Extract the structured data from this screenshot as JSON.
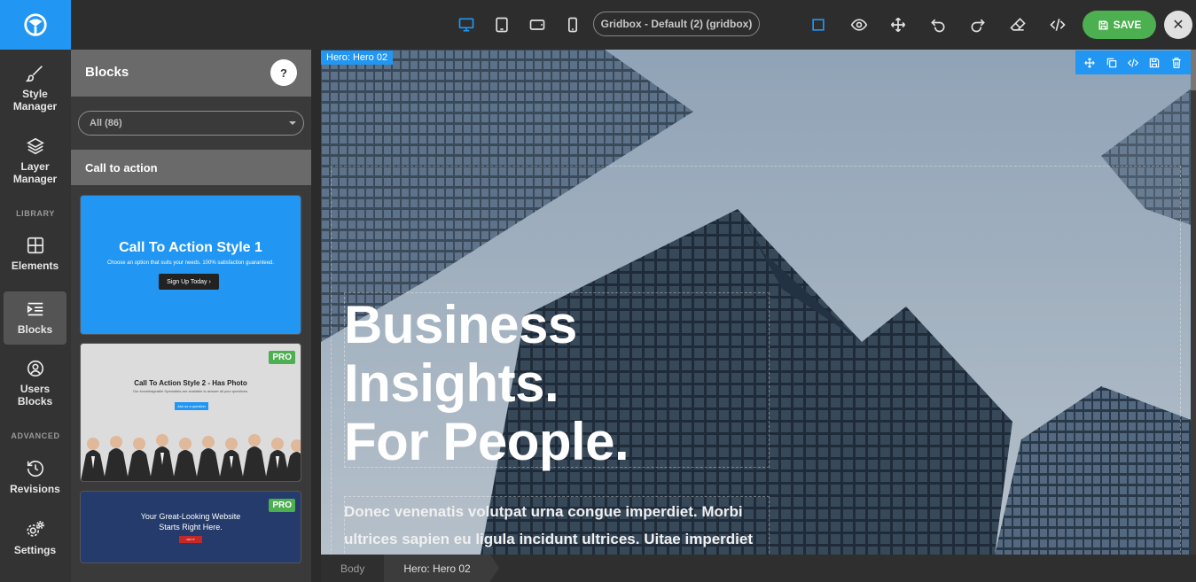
{
  "topbar": {
    "devices": [
      "desktop-icon",
      "tablet-icon",
      "tablet-landscape-icon",
      "mobile-icon"
    ],
    "preset_label": "Gridbox - Default (2) (gridbox)",
    "save_label": "SAVE",
    "accent": "#2196f3",
    "save_color": "#4caf50"
  },
  "rail": {
    "style_manager": "Style Manager",
    "layer_manager": "Layer Manager",
    "library_heading": "LIBRARY",
    "elements": "Elements",
    "blocks": "Blocks",
    "users_blocks": "Users Blocks",
    "advanced_heading": "ADVANCED",
    "revisions": "Revisions",
    "settings": "Settings"
  },
  "panel": {
    "title": "Blocks",
    "help": "?",
    "filter_value": "All (86)",
    "category": "Call to action",
    "blocks": [
      {
        "title": "Call To Action Style 1",
        "subtitle": "Choose an option that suits your needs. 100% satisfaction guaranteed.",
        "button": "Sign Up Today ›"
      },
      {
        "title": "Call To Action Style 2 - Has Photo",
        "subtitle": "Our knowledgeable Specialists are available to answer all your questions.",
        "button": "Ask us a question",
        "badge": "PRO"
      },
      {
        "title": "Your Great-Looking Website Starts Right Here.",
        "button": "GET IT",
        "badge": "PRO"
      }
    ]
  },
  "canvas": {
    "section_label": "Hero: Hero 02",
    "heading": "Business\nInsights.\nFor People.",
    "paragraph": "Donec venenatis volutpat urna congue imperdiet. Morbi ultrices sapien eu ligula incidunt ultrices. Uitae imperdiet"
  },
  "breadcrumb": {
    "items": [
      "Body",
      "Hero: Hero 02"
    ]
  }
}
